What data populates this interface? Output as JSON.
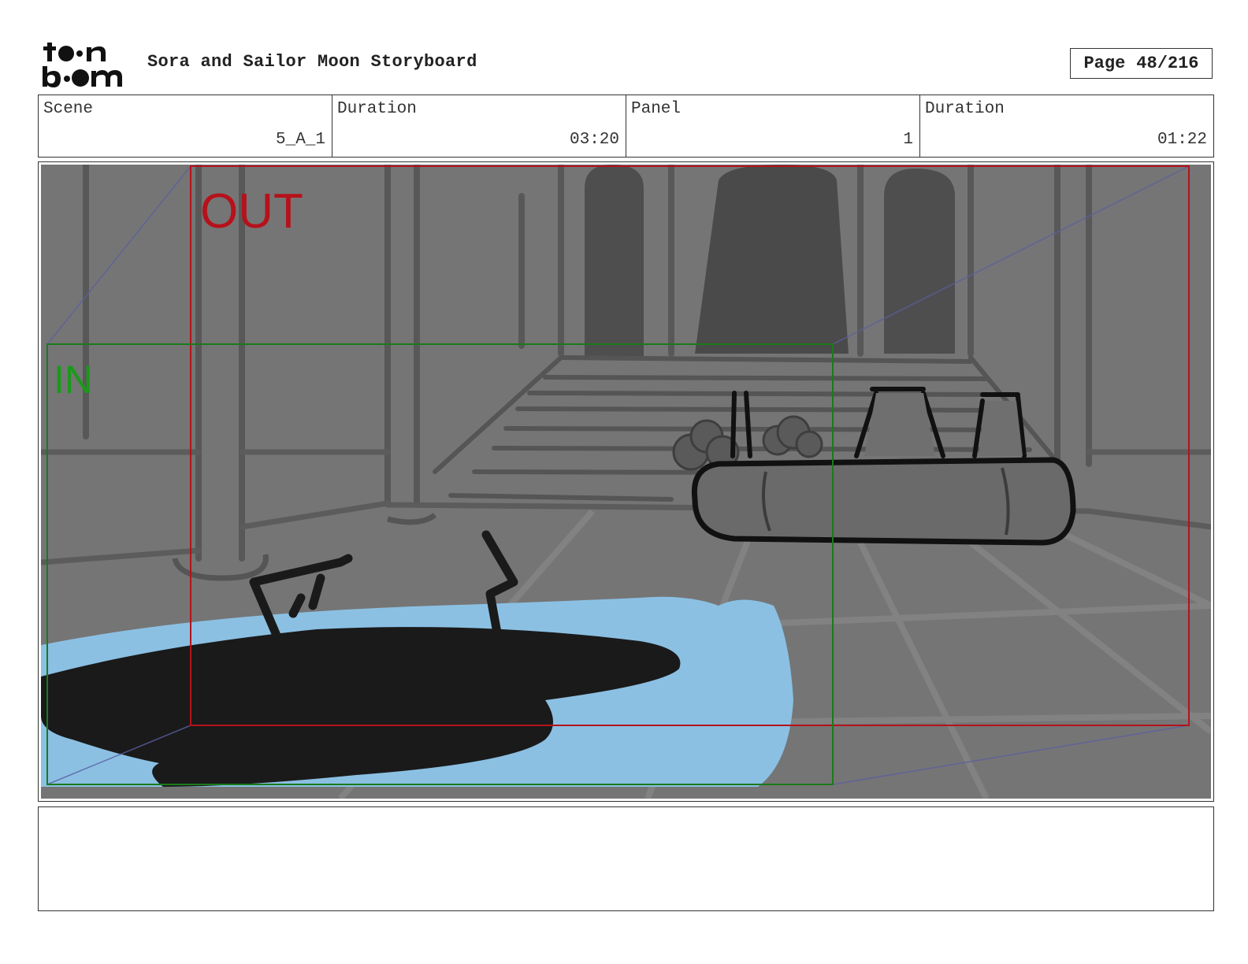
{
  "header": {
    "logo_text": "toon boom",
    "title": "Sora and Sailor Moon Storyboard",
    "page_label": "Page",
    "page_value": "48/216"
  },
  "info": {
    "scene_label": "Scene",
    "scene_value": "5_A_1",
    "scene_duration_label": "Duration",
    "scene_duration_value": "03:20",
    "panel_label": "Panel",
    "panel_value": "1",
    "panel_duration_label": "Duration",
    "panel_duration_value": "01:22"
  },
  "panel": {
    "out_label": "OUT",
    "in_label": "IN",
    "out_color": "#b5121b",
    "in_color": "#1a9a1a",
    "background_color": "#757575",
    "water_color": "#8bc0e3"
  },
  "notes": {
    "text": ""
  }
}
